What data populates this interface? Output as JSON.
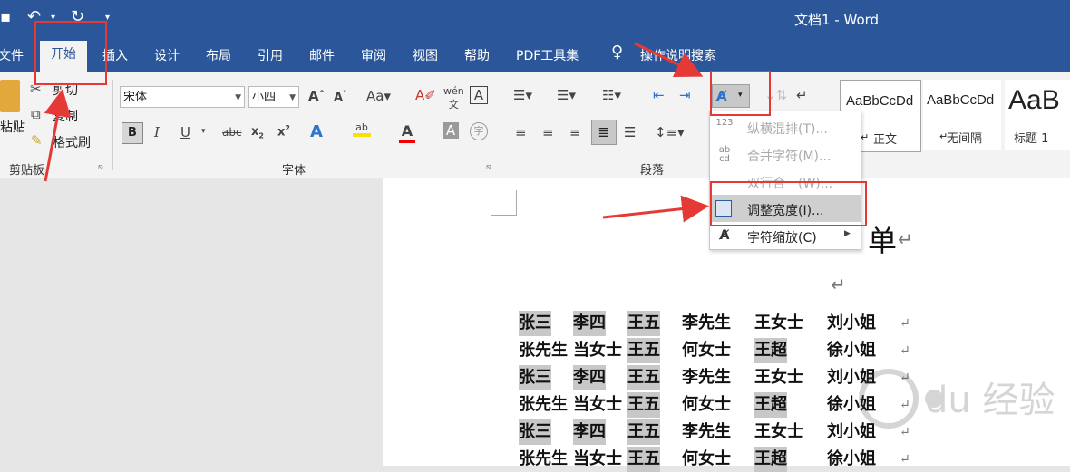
{
  "window": {
    "title": "文档1  -  Word"
  },
  "quick_access": {
    "save_icon": "save-icon",
    "undo_icon": "undo-icon",
    "redo_icon": "redo-icon",
    "customize_icon": "dropdown-icon"
  },
  "tabs": [
    {
      "label": "文件"
    },
    {
      "label": "开始"
    },
    {
      "label": "插入"
    },
    {
      "label": "设计"
    },
    {
      "label": "布局"
    },
    {
      "label": "引用"
    },
    {
      "label": "邮件"
    },
    {
      "label": "审阅"
    },
    {
      "label": "视图"
    },
    {
      "label": "帮助"
    },
    {
      "label": "PDF工具集"
    },
    {
      "label": "操作说明搜索"
    }
  ],
  "clipboard": {
    "paste": "粘贴",
    "cut": "剪切",
    "copy": "复制",
    "format_painter": "格式刷",
    "group_label": "剪贴板"
  },
  "font": {
    "family": "宋体",
    "size": "小四",
    "group_label": "字体"
  },
  "paragraph": {
    "group_label": "段落"
  },
  "styles": [
    {
      "sample": "AaBbCcDd",
      "name": "正文"
    },
    {
      "sample": "AaBbCcDd",
      "name": "无间隔"
    },
    {
      "sample": "AaB",
      "name": "标题 1"
    }
  ],
  "dropdown_menu": {
    "items": [
      {
        "icon_text": "123",
        "label": "纵横混排(T)...",
        "enabled": false
      },
      {
        "icon_text": "ab cd",
        "label": "合并字符(M)...",
        "enabled": false
      },
      {
        "icon_text": "",
        "label": "双行合一(W)...",
        "enabled": false
      },
      {
        "icon_text": "",
        "label": "调整宽度(I)...",
        "enabled": true
      },
      {
        "icon_text": "",
        "label": "字符缩放(C)",
        "enabled": true
      }
    ]
  },
  "document": {
    "heading_char": "单",
    "rows": [
      [
        "张三",
        "李四",
        "王五",
        "李先生",
        "王女士",
        "刘小姐"
      ],
      [
        "张先生",
        "当女士",
        "王五",
        "何女士",
        "王超",
        "徐小姐"
      ],
      [
        "张三",
        "李四",
        "王五",
        "李先生",
        "王女士",
        "刘小姐"
      ],
      [
        "张先生",
        "当女士",
        "王五",
        "何女士",
        "王超",
        "徐小姐"
      ],
      [
        "张三",
        "李四",
        "王五",
        "李先生",
        "王女士",
        "刘小姐"
      ],
      [
        "张先生",
        "当女士",
        "王五",
        "何女士",
        "王超",
        "徐小姐"
      ]
    ]
  }
}
